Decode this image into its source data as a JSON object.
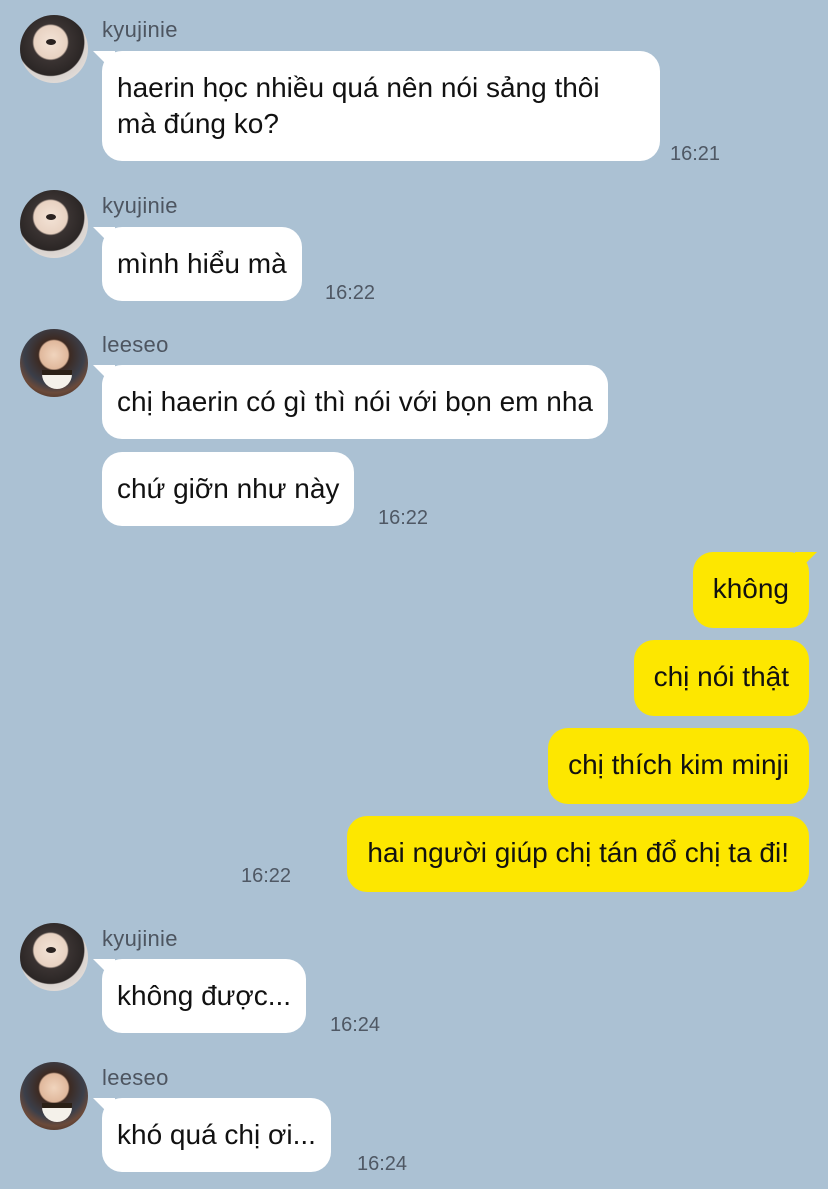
{
  "messages": [
    {
      "sender": "kyujinie",
      "text_line1": "haerin học nhiều quá nên nói sảng thôi",
      "text_line2": "mà đúng ko?",
      "time": "16:21"
    },
    {
      "sender": "kyujinie",
      "text": "mình hiểu mà",
      "time": "16:22"
    },
    {
      "sender": "leeseo",
      "text": "chị haerin có gì thì nói với bọn em nha",
      "text2": "chứ giỡn như này",
      "time": "16:22"
    },
    {
      "outgoing": [
        "không",
        "chị nói thật",
        "chị thích kim minji",
        "hai người giúp chị tán đổ chị ta đi!"
      ],
      "time": "16:22"
    },
    {
      "sender": "kyujinie",
      "text": "không được...",
      "time": "16:24"
    },
    {
      "sender": "leeseo",
      "text": "khó quá chị ơi...",
      "time": "16:24"
    }
  ],
  "colors": {
    "background": "#abc1d3",
    "incoming_bubble": "#ffffff",
    "outgoing_bubble": "#fde700"
  },
  "icons": {
    "avatar_kyujinie": "profile-photo",
    "avatar_leeseo": "profile-photo"
  }
}
